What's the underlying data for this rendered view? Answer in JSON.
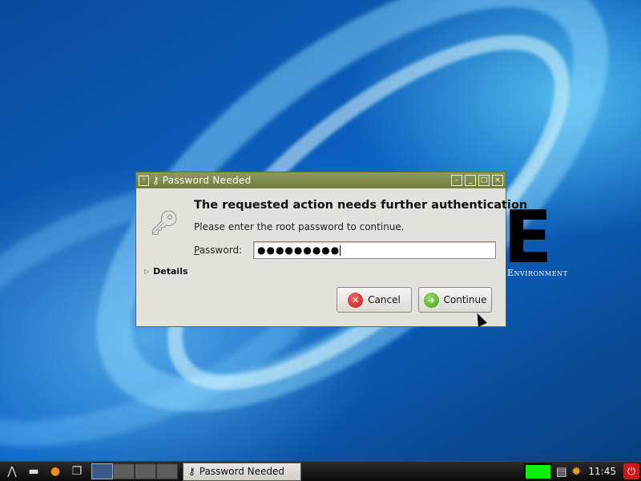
{
  "desktop": {
    "logo_letter": "E",
    "logo_subtitle": "Environment"
  },
  "dialog": {
    "title": "Password Needed",
    "heading": "The requested action needs further authentication",
    "message": "Please enter the root password to continue.",
    "password_label_accel": "P",
    "password_label_rest": "assword:",
    "password_value": "●●●●●●●●●",
    "details_label": "Details",
    "cancel_label": "Cancel",
    "continue_label": "Continue",
    "titlebar_buttons": [
      "–",
      "_",
      "□",
      "×"
    ],
    "icons": {
      "window_menu": "grid-icon",
      "title": "key-icon",
      "main": "key-icon",
      "cancel": "cancel-x-icon",
      "continue": "arrow-right-icon"
    }
  },
  "taskbar": {
    "launchers": [
      "lxde-menu-icon",
      "desktop-icon",
      "firefox-icon",
      "window-switch-icon"
    ],
    "workspaces": 4,
    "active_workspace": 1,
    "task_button_label": "Password Needed",
    "clock": "11:45",
    "cpu_color": "#0cf10c",
    "accent": "#6f7d3f"
  }
}
